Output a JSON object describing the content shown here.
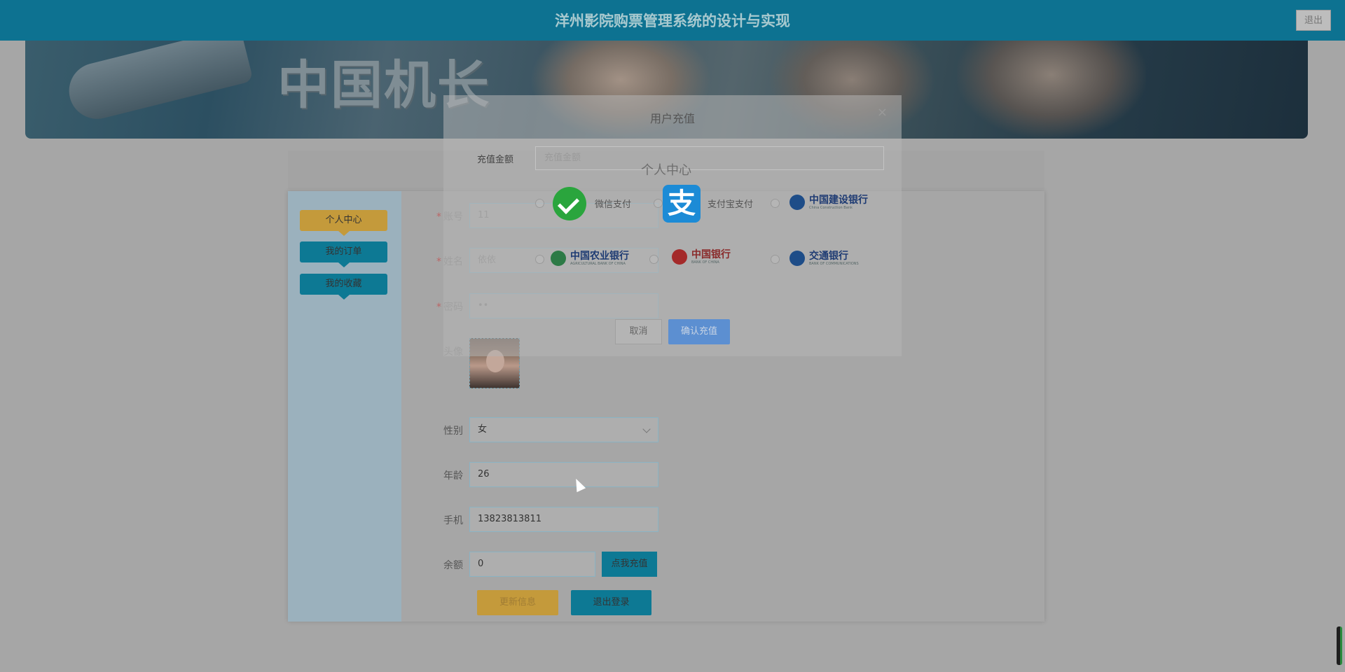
{
  "header": {
    "title": "洋州影院购票管理系统的设计与实现",
    "logout_label": "退出"
  },
  "banner": {
    "movie_title": "中国机长"
  },
  "center_header": {
    "title": "个人中心"
  },
  "sidebar": {
    "items": [
      {
        "label": "个人中心",
        "active": true
      },
      {
        "label": "我的订单",
        "active": false
      },
      {
        "label": "我的收藏",
        "active": false
      }
    ]
  },
  "form": {
    "account": {
      "label": "账号",
      "value": "11"
    },
    "name": {
      "label": "姓名",
      "value": "依依"
    },
    "password": {
      "label": "密码",
      "value": "••"
    },
    "avatar": {
      "label": "头像"
    },
    "gender": {
      "label": "性别",
      "value": "女"
    },
    "age": {
      "label": "年龄",
      "value": "26"
    },
    "phone": {
      "label": "手机",
      "value": "13823813811"
    },
    "balance": {
      "label": "余额",
      "value": "0",
      "recharge_label": "点我充值"
    },
    "update_label": "更新信息",
    "logout_label": "退出登录"
  },
  "modal": {
    "title": "用户充值",
    "close": "×",
    "amount_label": "充值金额",
    "amount_placeholder": "充值金额",
    "payments": [
      {
        "label": "微信支付",
        "icon": "wechat-pay-icon"
      },
      {
        "label": "支付宝支付",
        "icon": "alipay-icon"
      },
      {
        "cn": "中国建设银行",
        "en": "China Construction Bank"
      },
      {
        "cn": "中国农业银行",
        "en": "AGRICULTURAL BANK OF CHINA"
      },
      {
        "cn": "中国银行",
        "en": "BANK OF CHINA"
      },
      {
        "cn": "交通银行",
        "en": "BANK OF COMMUNICATIONS"
      }
    ],
    "cancel_label": "取消",
    "confirm_label": "确认充值"
  }
}
